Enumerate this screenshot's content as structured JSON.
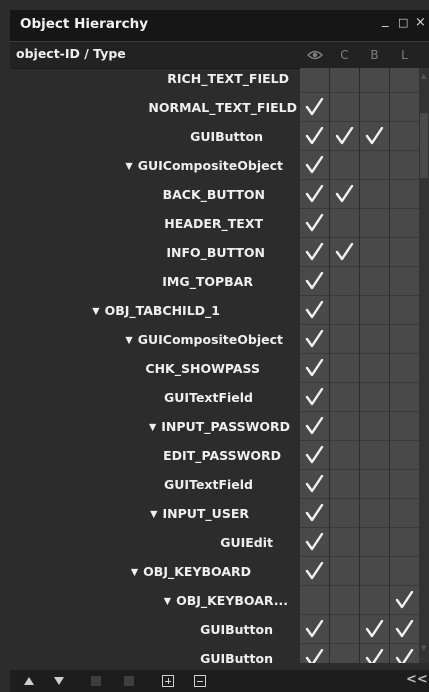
{
  "window": {
    "title": "Object Hierarchy",
    "minimize_glyph": "_",
    "maximize_glyph": "□",
    "close_glyph": "×"
  },
  "header": {
    "label": "object-ID / Type",
    "columns": [
      {
        "id": "visible",
        "icon": "eye-icon",
        "label": ""
      },
      {
        "id": "c",
        "label": "C"
      },
      {
        "id": "b",
        "label": "B"
      },
      {
        "id": "l",
        "label": "L"
      }
    ]
  },
  "colors": {
    "title_bg": "#161616",
    "panel_bg": "#2c2c2c",
    "cell_bg": "#494949",
    "check": "#f2f2f2"
  },
  "rows": [
    {
      "label": "RICH_TEXT_FIELD",
      "expander": "",
      "checks": [
        false,
        false,
        false,
        false
      ]
    },
    {
      "label": "NORMAL_TEXT_FIELD",
      "expander": "",
      "checks": [
        true,
        false,
        false,
        false
      ]
    },
    {
      "label": "GUIButton",
      "expander": "",
      "checks": [
        true,
        true,
        true,
        false
      ]
    },
    {
      "label": "GUICompositeObject",
      "expander": "▼",
      "checks": [
        true,
        false,
        false,
        false
      ]
    },
    {
      "label": "BACK_BUTTON",
      "expander": "",
      "checks": [
        true,
        true,
        false,
        false
      ]
    },
    {
      "label": "HEADER_TEXT",
      "expander": "",
      "checks": [
        true,
        false,
        false,
        false
      ]
    },
    {
      "label": "INFO_BUTTON",
      "expander": "",
      "checks": [
        true,
        true,
        false,
        false
      ]
    },
    {
      "label": "IMG_TOPBAR",
      "expander": "",
      "checks": [
        true,
        false,
        false,
        false
      ]
    },
    {
      "label": "OBJ_TABCHILD_1",
      "expander": "▼",
      "checks": [
        true,
        false,
        false,
        false
      ]
    },
    {
      "label": "GUICompositeObject",
      "expander": "▼",
      "checks": [
        true,
        false,
        false,
        false
      ]
    },
    {
      "label": "CHK_SHOWPASS",
      "expander": "",
      "checks": [
        true,
        false,
        false,
        false
      ]
    },
    {
      "label": "GUITextField",
      "expander": "",
      "checks": [
        true,
        false,
        false,
        false
      ]
    },
    {
      "label": "INPUT_PASSWORD",
      "expander": "▼",
      "checks": [
        true,
        false,
        false,
        false
      ]
    },
    {
      "label": "EDIT_PASSWORD",
      "expander": "",
      "checks": [
        true,
        false,
        false,
        false
      ]
    },
    {
      "label": "GUITextField",
      "expander": "",
      "checks": [
        true,
        false,
        false,
        false
      ]
    },
    {
      "label": "INPUT_USER",
      "expander": "▼",
      "checks": [
        true,
        false,
        false,
        false
      ]
    },
    {
      "label": "GUIEdit",
      "expander": "",
      "checks": [
        true,
        false,
        false,
        false
      ]
    },
    {
      "label": "OBJ_KEYBOARD",
      "expander": "▼",
      "checks": [
        true,
        false,
        false,
        false
      ]
    },
    {
      "label": "OBJ_KEYBOAR...",
      "expander": "▼",
      "checks": [
        false,
        false,
        false,
        true
      ]
    },
    {
      "label": "GUIButton",
      "expander": "",
      "checks": [
        true,
        false,
        true,
        true
      ]
    },
    {
      "label": "GUIButton",
      "expander": "",
      "checks": [
        true,
        false,
        true,
        true
      ]
    }
  ],
  "toolbar": {
    "buttons": [
      {
        "id": "move-up",
        "icon": "triangle-up-icon"
      },
      {
        "id": "move-down",
        "icon": "triangle-down-icon"
      },
      {
        "id": "disabled-1",
        "icon": "square-icon"
      },
      {
        "id": "disabled-2",
        "icon": "square-icon"
      },
      {
        "id": "expand",
        "icon": "plus-box-icon"
      },
      {
        "id": "collapse",
        "icon": "minus-box-icon"
      }
    ],
    "collapse_panel_glyph": "<<"
  }
}
